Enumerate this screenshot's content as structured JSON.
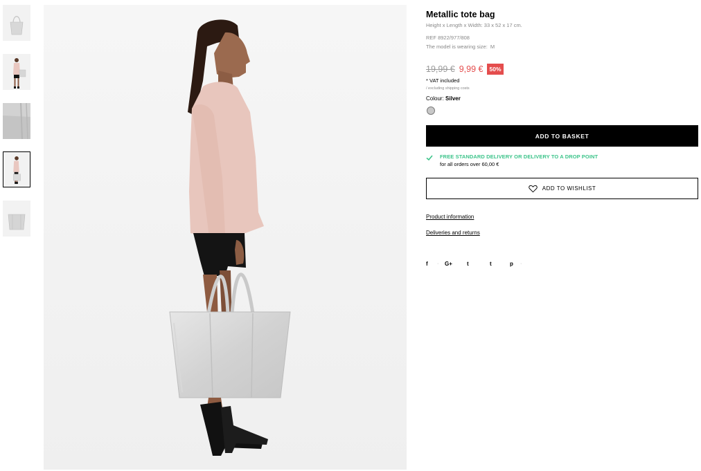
{
  "thumbnails": [
    {
      "name": "thumbnail-bag-front",
      "active": false
    },
    {
      "name": "thumbnail-model-front",
      "active": false
    },
    {
      "name": "thumbnail-bag-detail",
      "active": false
    },
    {
      "name": "thumbnail-model-side",
      "active": true
    },
    {
      "name": "thumbnail-bag-flat",
      "active": false
    }
  ],
  "product": {
    "title": "Metallic tote bag",
    "dimensions": "Height x Length x Width: 33 x 52 x 17 cm.",
    "ref": "REF 8922/977/808",
    "model_label": "The model is wearing size:",
    "model_size": "M"
  },
  "price": {
    "old": "19,99 €",
    "new": "9,99 €",
    "discount": "50%",
    "vat": "* VAT included",
    "shipping_note": "/ excluding shipping costs"
  },
  "colour": {
    "label": "Colour:",
    "value": "Silver",
    "swatch_color": "#c8c8c8"
  },
  "actions": {
    "add_to_basket": "ADD TO BASKET",
    "add_to_wishlist": "ADD TO WISHLIST"
  },
  "delivery": {
    "title": "FREE STANDARD DELIVERY OR DELIVERY TO A DROP POINT",
    "subtitle": "for all orders over 60,00 €",
    "accent_color": "#3cc48a"
  },
  "links": {
    "product_information": "Product information",
    "deliveries_returns": "Deliveries and returns"
  },
  "social": {
    "facebook": "f",
    "google_plus": "G+",
    "twitter": "t",
    "tumblr": "t",
    "pinterest": "p"
  },
  "colors": {
    "sale": "#e44d4d",
    "primary_button": "#000000"
  }
}
